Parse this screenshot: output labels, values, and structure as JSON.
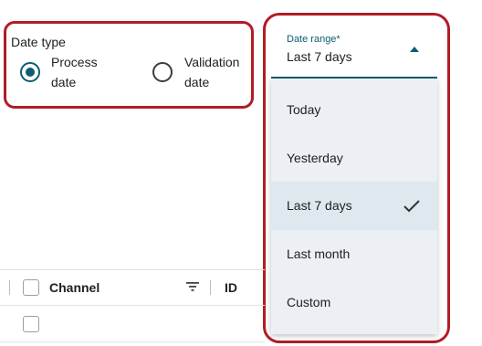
{
  "date_type": {
    "label": "Date type",
    "options": [
      {
        "label_line1": "Process",
        "label_line2": "date",
        "checked": true
      },
      {
        "label_line1": "Validation",
        "label_line2": "date",
        "checked": false
      }
    ]
  },
  "date_range": {
    "label": "Date range*",
    "value": "Last 7 days",
    "options": [
      "Today",
      "Yesterday",
      "Last 7 days",
      "Last month",
      "Custom"
    ],
    "selected_option": "Last 7 days"
  },
  "table": {
    "columns": [
      "Channel",
      "ID"
    ]
  },
  "colors": {
    "accent": "#0b5e72",
    "highlight_outline": "#b21c24",
    "menu_background": "#eceff3",
    "selected_item_background": "#dde9ee"
  }
}
